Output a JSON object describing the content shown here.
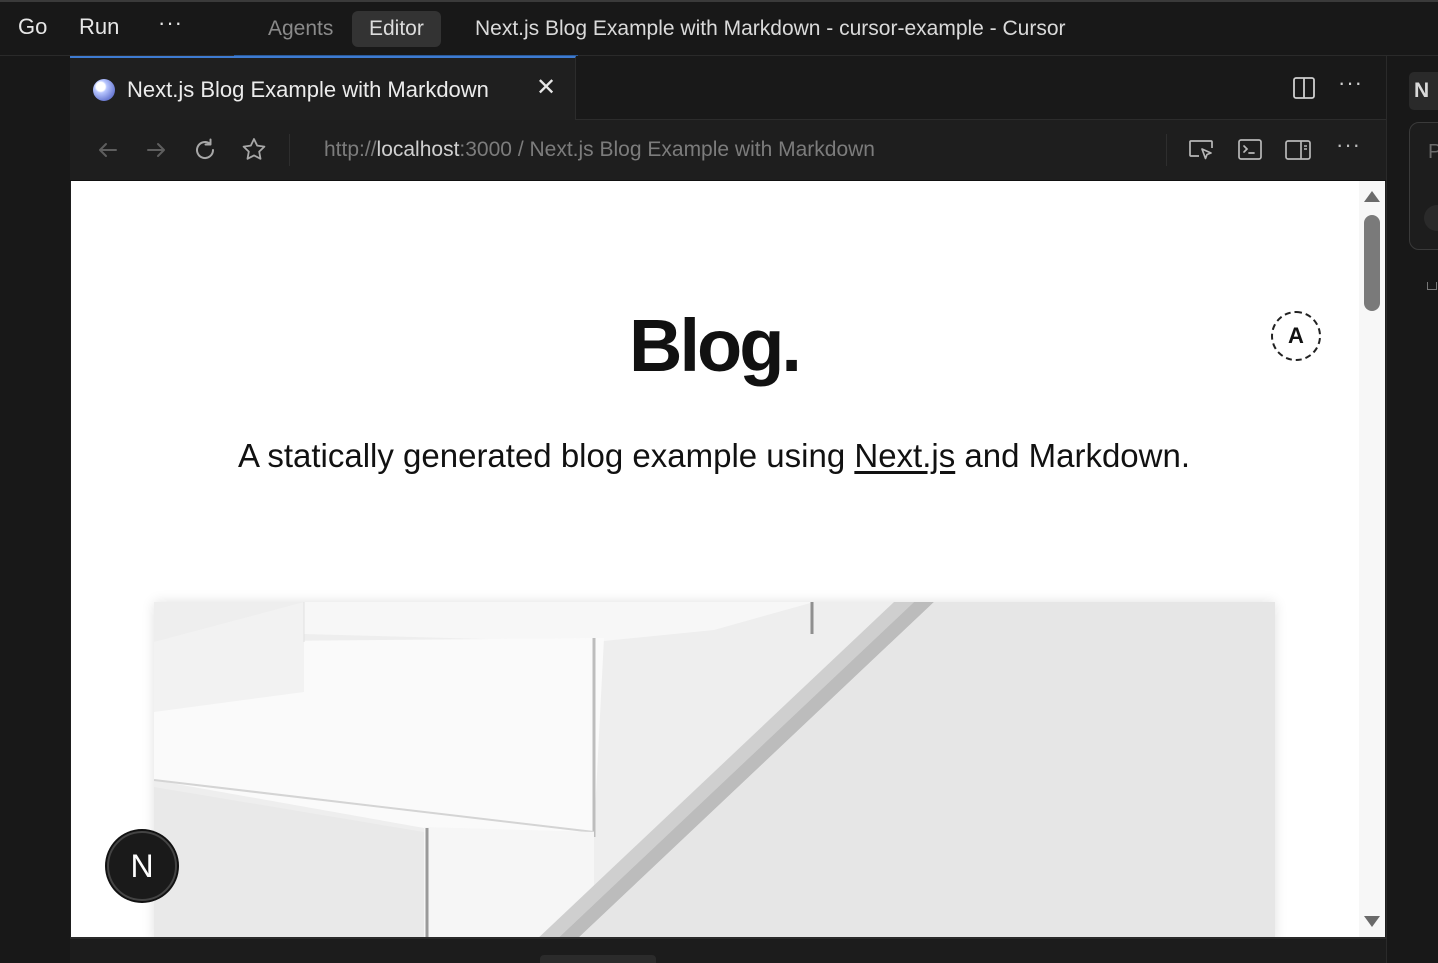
{
  "titlebar": {
    "menu_go": "Go",
    "menu_run": "Run",
    "more": "···",
    "agents_label": "Agents",
    "editor_label": "Editor",
    "window_title": "Next.js Blog Example with Markdown - cursor-example - Cursor"
  },
  "browser": {
    "tab_title": "Next.js Blog Example with Markdown",
    "tab_close": "✕",
    "more": "···",
    "url_scheme": "http://",
    "url_host": "localhost",
    "url_port": ":3000",
    "url_sep": " / ",
    "url_page_title": "Next.js Blog Example with Markdown"
  },
  "page": {
    "title": "Blog.",
    "intro_before": "A statically generated blog example using ",
    "intro_link": "Next.js",
    "intro_after": " and Markdown.",
    "avatar_letter": "A",
    "next_badge_letter": "N"
  },
  "right_panel": {
    "tab_letter": "N",
    "card_letter": "P"
  },
  "icons": {
    "favicon": "globe-icon",
    "back": "arrow-left-icon",
    "forward": "arrow-right-icon",
    "reload": "reload-icon",
    "bookmark": "star-icon",
    "select_element": "select-element-icon",
    "console": "terminal-icon",
    "sidebar": "sidebar-icon",
    "split": "split-editor-icon"
  },
  "colors": {
    "accent": "#3e7bd1",
    "page_bg": "#ffffff",
    "chrome_bg": "#1e1e1e"
  }
}
